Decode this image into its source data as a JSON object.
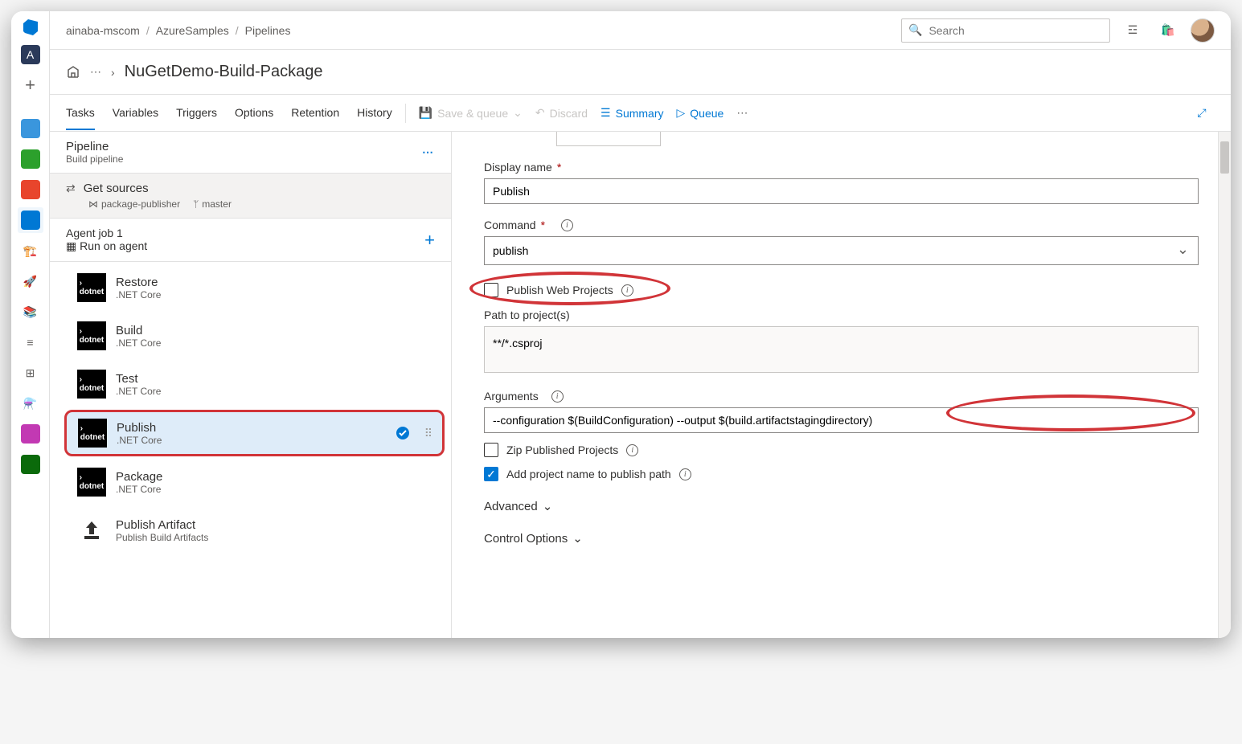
{
  "header": {
    "org": "ainaba-mscom",
    "project": "AzureSamples",
    "area": "Pipelines",
    "search_placeholder": "Search"
  },
  "title": {
    "name": "NuGetDemo-Build-Package"
  },
  "tabs": {
    "items": [
      "Tasks",
      "Variables",
      "Triggers",
      "Options",
      "Retention",
      "History"
    ],
    "active": "Tasks"
  },
  "commands": {
    "save_queue": "Save & queue",
    "discard": "Discard",
    "summary": "Summary",
    "queue": "Queue"
  },
  "pipeline": {
    "label": "Pipeline",
    "sub": "Build pipeline",
    "get_sources": "Get sources",
    "repo": "package-publisher",
    "branch": "master",
    "job": "Agent job 1",
    "job_sub": "Run on agent",
    "tasks": [
      {
        "name": "Restore",
        "sub": ".NET Core",
        "icon": "dotnet"
      },
      {
        "name": "Build",
        "sub": ".NET Core",
        "icon": "dotnet"
      },
      {
        "name": "Test",
        "sub": ".NET Core",
        "icon": "dotnet"
      },
      {
        "name": "Publish",
        "sub": ".NET Core",
        "icon": "dotnet",
        "selected": true
      },
      {
        "name": "Package",
        "sub": ".NET Core",
        "icon": "dotnet"
      },
      {
        "name": "Publish Artifact",
        "sub": "Publish Build Artifacts",
        "icon": "upload"
      }
    ]
  },
  "form": {
    "display_name_label": "Display name",
    "display_name": "Publish",
    "command_label": "Command",
    "command": "publish",
    "publish_web_label": "Publish Web Projects",
    "publish_web_checked": false,
    "path_label": "Path to project(s)",
    "path_value": "**/*.csproj",
    "arguments_label": "Arguments",
    "arguments_value": "--configuration $(BuildConfiguration) --output $(build.artifactstagingdirectory)",
    "zip_label": "Zip Published Projects",
    "zip_checked": false,
    "add_project_label": "Add project name to publish path",
    "add_project_checked": true,
    "advanced": "Advanced",
    "control_options": "Control Options"
  }
}
